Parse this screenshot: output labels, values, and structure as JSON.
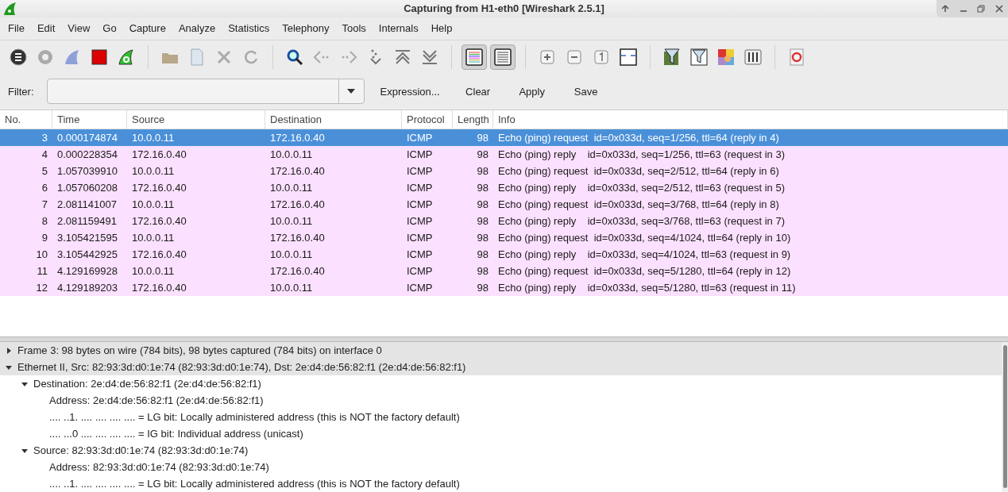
{
  "window": {
    "title": "Capturing from H1-eth0 [Wireshark 2.5.1]"
  },
  "menu": [
    "File",
    "Edit",
    "View",
    "Go",
    "Capture",
    "Analyze",
    "Statistics",
    "Telephony",
    "Tools",
    "Internals",
    "Help"
  ],
  "view_toggles": [
    {
      "pressed": true
    },
    {
      "pressed": true
    }
  ],
  "filter": {
    "label": "Filter:",
    "buttons": [
      "Expression...",
      "Clear",
      "Apply",
      "Save"
    ]
  },
  "columns": [
    "No.",
    "Time",
    "Source",
    "Destination",
    "Protocol",
    "Length",
    "Info"
  ],
  "rows": [
    {
      "no": "3",
      "time": "0.000174874",
      "source": "10.0.0.11",
      "destination": "172.16.0.40",
      "protocol": "ICMP",
      "length": "98",
      "info": "Echo (ping) request  id=0x033d, seq=1/256, ttl=64 (reply in 4)",
      "selected": true
    },
    {
      "no": "4",
      "time": "0.000228354",
      "source": "172.16.0.40",
      "destination": "10.0.0.11",
      "protocol": "ICMP",
      "length": "98",
      "info": "Echo (ping) reply    id=0x033d, seq=1/256, ttl=63 (request in 3)",
      "selected": false
    },
    {
      "no": "5",
      "time": "1.057039910",
      "source": "10.0.0.11",
      "destination": "172.16.0.40",
      "protocol": "ICMP",
      "length": "98",
      "info": "Echo (ping) request  id=0x033d, seq=2/512, ttl=64 (reply in 6)",
      "selected": false
    },
    {
      "no": "6",
      "time": "1.057060208",
      "source": "172.16.0.40",
      "destination": "10.0.0.11",
      "protocol": "ICMP",
      "length": "98",
      "info": "Echo (ping) reply    id=0x033d, seq=2/512, ttl=63 (request in 5)",
      "selected": false
    },
    {
      "no": "7",
      "time": "2.081141007",
      "source": "10.0.0.11",
      "destination": "172.16.0.40",
      "protocol": "ICMP",
      "length": "98",
      "info": "Echo (ping) request  id=0x033d, seq=3/768, ttl=64 (reply in 8)",
      "selected": false
    },
    {
      "no": "8",
      "time": "2.081159491",
      "source": "172.16.0.40",
      "destination": "10.0.0.11",
      "protocol": "ICMP",
      "length": "98",
      "info": "Echo (ping) reply    id=0x033d, seq=3/768, ttl=63 (request in 7)",
      "selected": false
    },
    {
      "no": "9",
      "time": "3.105421595",
      "source": "10.0.0.11",
      "destination": "172.16.0.40",
      "protocol": "ICMP",
      "length": "98",
      "info": "Echo (ping) request  id=0x033d, seq=4/1024, ttl=64 (reply in 10)",
      "selected": false
    },
    {
      "no": "10",
      "time": "3.105442925",
      "source": "172.16.0.40",
      "destination": "10.0.0.11",
      "protocol": "ICMP",
      "length": "98",
      "info": "Echo (ping) reply    id=0x033d, seq=4/1024, ttl=63 (request in 9)",
      "selected": false
    },
    {
      "no": "11",
      "time": "4.129169928",
      "source": "10.0.0.11",
      "destination": "172.16.0.40",
      "protocol": "ICMP",
      "length": "98",
      "info": "Echo (ping) request  id=0x033d, seq=5/1280, ttl=64 (reply in 12)",
      "selected": false
    },
    {
      "no": "12",
      "time": "4.129189203",
      "source": "172.16.0.40",
      "destination": "10.0.0.11",
      "protocol": "ICMP",
      "length": "98",
      "info": "Echo (ping) reply    id=0x033d, seq=5/1280, ttl=63 (request in 11)",
      "selected": false
    }
  ],
  "details": [
    {
      "text": "Frame 3: 98 bytes on wire (784 bits), 98 bytes captured (784 bits) on interface 0",
      "expanded": false
    },
    {
      "text": "Ethernet II, Src: 82:93:3d:d0:1e:74 (82:93:3d:d0:1e:74), Dst: 2e:d4:de:56:82:f1 (2e:d4:de:56:82:f1)",
      "expanded": true,
      "children": [
        {
          "text": "Destination: 2e:d4:de:56:82:f1 (2e:d4:de:56:82:f1)",
          "expanded": true,
          "children": [
            {
              "text": "Address: 2e:d4:de:56:82:f1 (2e:d4:de:56:82:f1)"
            },
            {
              "text": ".... ..1. .... .... .... .... = LG bit: Locally administered address (this is NOT the factory default)"
            },
            {
              "text": ".... ...0 .... .... .... .... = IG bit: Individual address (unicast)"
            }
          ]
        },
        {
          "text": "Source: 82:93:3d:d0:1e:74 (82:93:3d:d0:1e:74)",
          "expanded": true,
          "children": [
            {
              "text": "Address: 82:93:3d:d0:1e:74 (82:93:3d:d0:1e:74)"
            },
            {
              "text": ".... ..1. .... .... .... .... = LG bit: Locally administered address (this is NOT the factory default)"
            }
          ]
        }
      ]
    }
  ]
}
